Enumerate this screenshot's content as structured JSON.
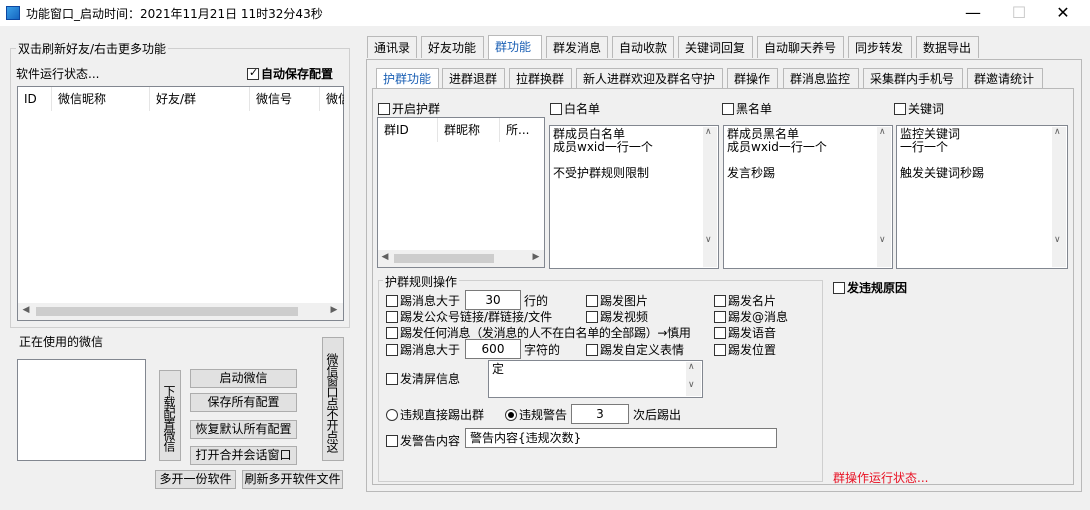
{
  "window": {
    "title": "功能窗口_启动时间：2021年11月21日 11时32分43秒",
    "minimize": "—",
    "maximize": "☐",
    "close": "✕"
  },
  "left": {
    "group_caption": "双击刷新好友/右击更多功能",
    "status_label": "软件运行状态...",
    "auto_save_label": "自动保存配置",
    "auto_save_checked": true,
    "columns": [
      "ID",
      "微信昵称",
      "好友/群",
      "微信号",
      "微信"
    ],
    "current_wechat_label": "正在使用的微信",
    "download_wechat": "下载配置微信",
    "start_wechat": "启动微信",
    "save_all": "保存所有配置",
    "restore_default": "恢复默认所有配置",
    "open_merge_window": "打开合并会话窗口",
    "wechat_window_toggle": "微信窗口点不开点这",
    "multi_open": "多开一份软件",
    "refresh_multi": "刷新多开软件文件"
  },
  "tabs": [
    "通讯录",
    "好友功能",
    "群功能",
    "群发消息",
    "自动收款",
    "关键词回复",
    "自动聊天养号",
    "同步转发",
    "数据导出"
  ],
  "active_tab": "群功能",
  "subtabs": [
    "护群功能",
    "进群退群",
    "拉群换群",
    "新人进群欢迎及群名守护",
    "群操作",
    "群消息监控",
    "采集群内手机号",
    "群邀请统计"
  ],
  "active_subtab": "护群功能",
  "protect": {
    "enable_label": "开启护群",
    "group_columns": [
      "群ID",
      "群昵称",
      "所..."
    ],
    "whitelist_label": "白名单",
    "whitelist_text": "群成员白名单\n成员wxid一行一个\n\n不受护群规则限制",
    "blacklist_label": "黑名单",
    "blacklist_text": "群成员黑名单\n成员wxid一行一个\n\n发言秒踢",
    "keyword_label": "关键词",
    "keyword_text": "监控关键词\n一行一个\n\n触发关键词秒踢"
  },
  "rules": {
    "caption": "护群规则操作",
    "kick_over_label": "踢消息大于",
    "kick_over_value": "30",
    "lines_unit": "行的",
    "kick_image": "踢发图片",
    "kick_card": "踢发名片",
    "kick_links": "踢发公众号链接/群链接/文件",
    "kick_video": "踢发视频",
    "kick_at": "踢发@消息",
    "kick_any": "踢发任何消息（发消息的人不在白名单的全部踢）→慎用",
    "kick_voice": "踢发语音",
    "kick_chars_label": "踢消息大于",
    "kick_chars_value": "600",
    "chars_unit": "字符的",
    "kick_emoji": "踢发自定义表情",
    "kick_location": "踢发位置",
    "clear_screen_label": "发清屏信息",
    "clear_screen_text": "定",
    "direct_kick": "违规直接踢出群",
    "warn_kick": "违规警告",
    "warn_count": "3",
    "warn_suffix": "次后踢出",
    "send_warning_label": "发警告内容",
    "warning_text": "警告内容{违规次数}",
    "violation_reason": "发违规原因",
    "status_text": "群操作运行状态..."
  }
}
